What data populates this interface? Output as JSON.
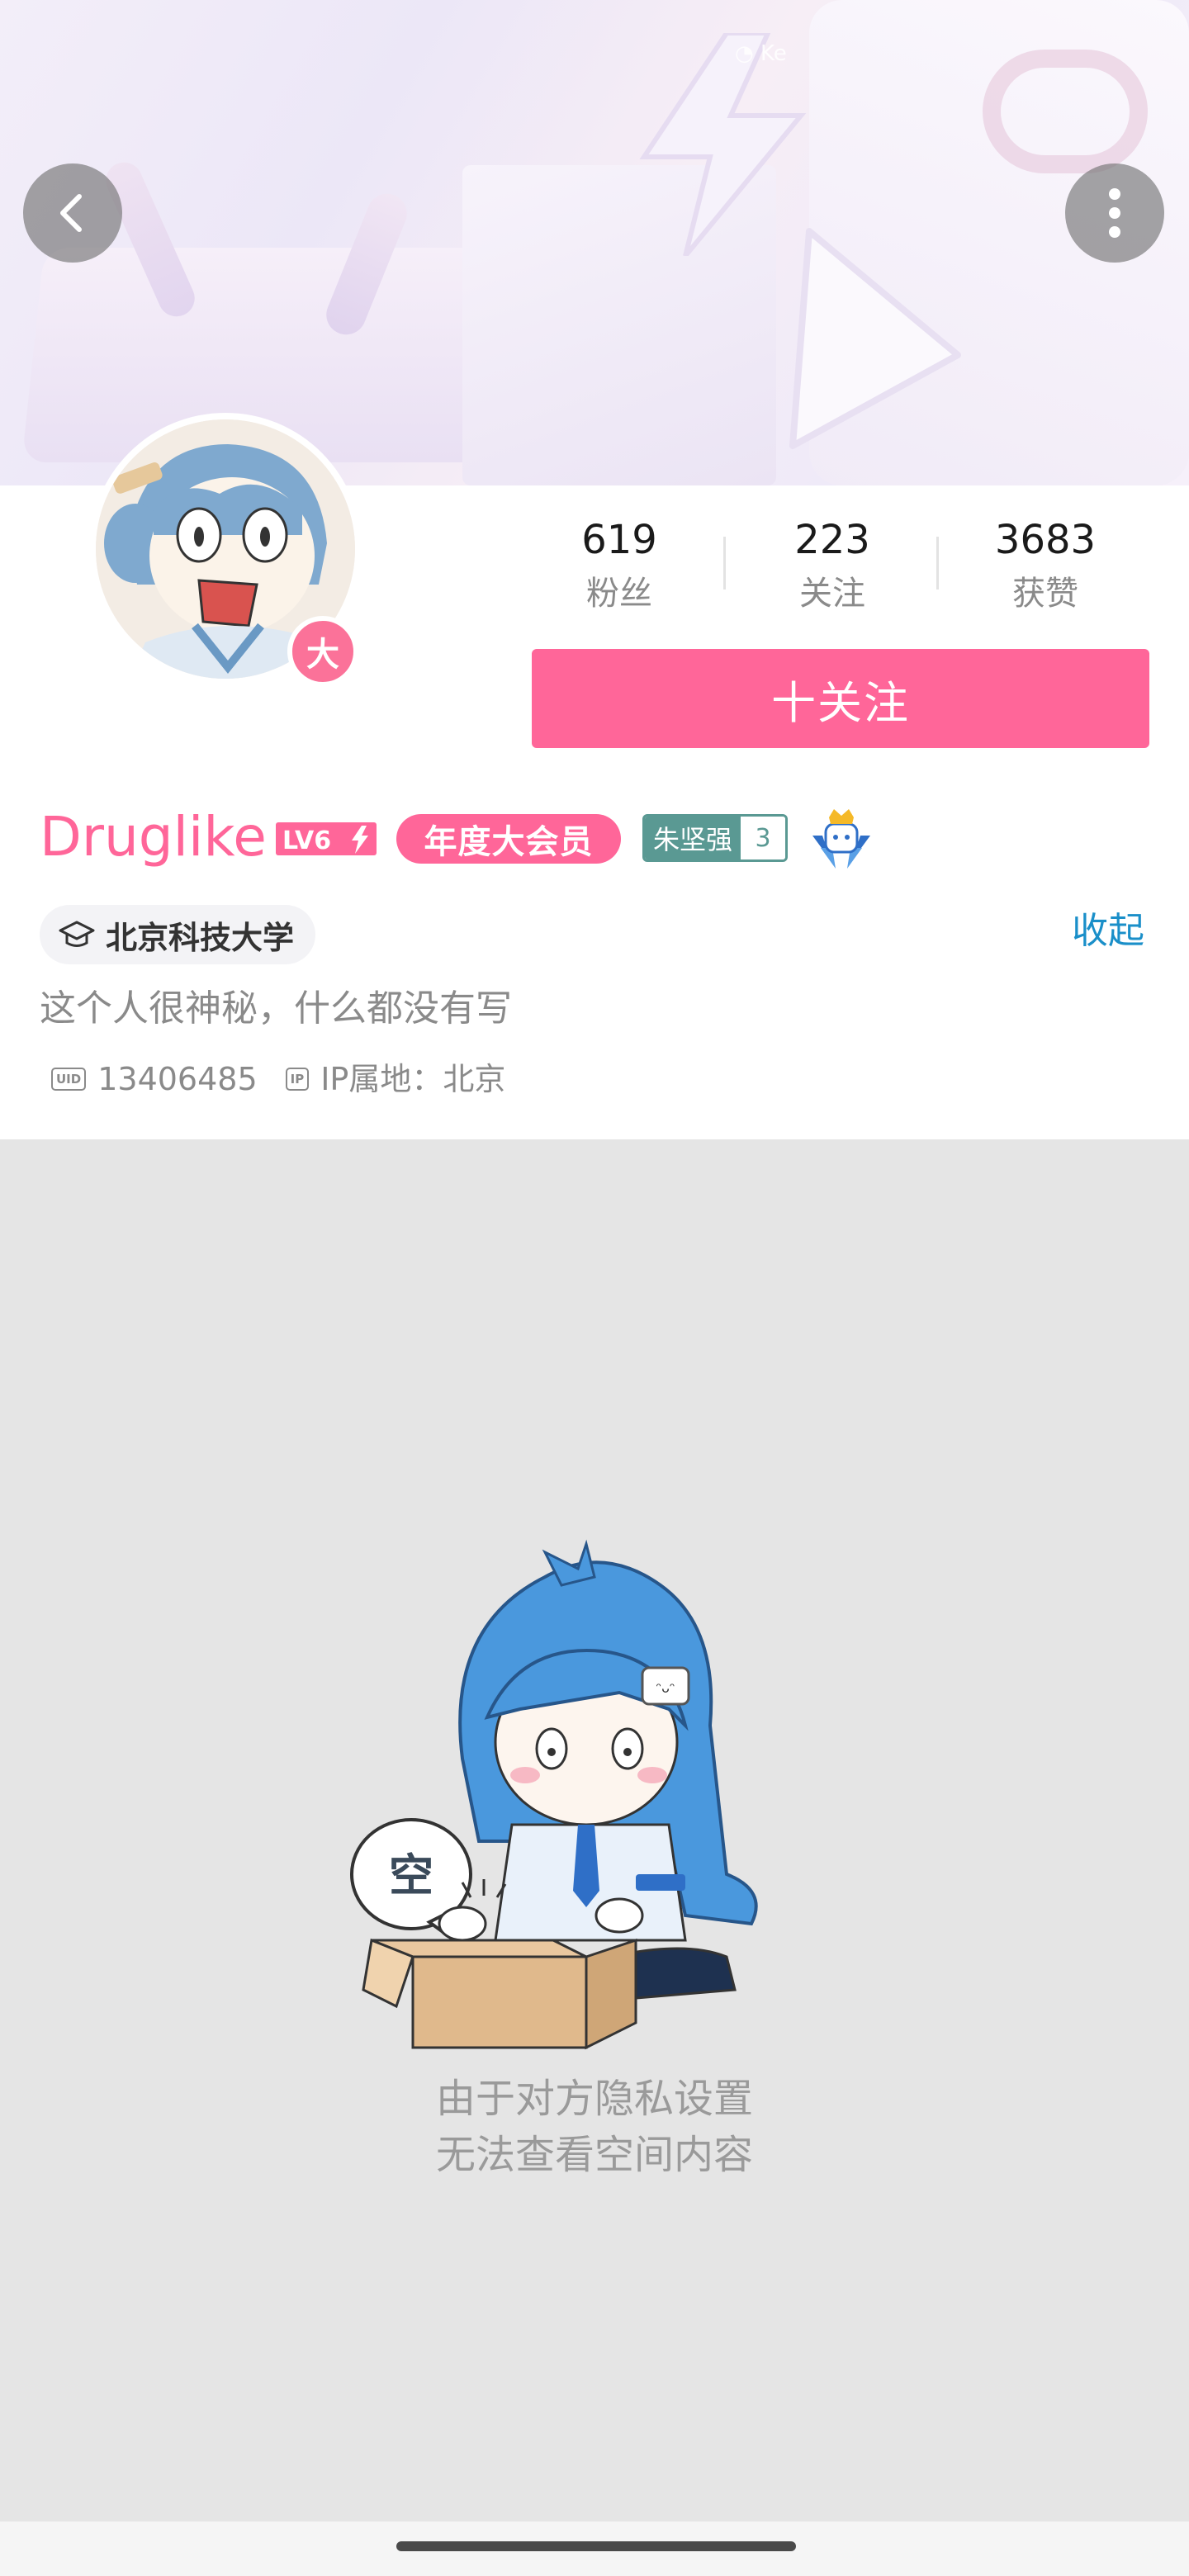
{
  "banner": {
    "logo_text": "◔ Ke"
  },
  "nav": {
    "back_icon": "chevron-left-icon",
    "more_icon": "more-vertical-icon"
  },
  "stats": [
    {
      "value": "619",
      "label": "粉丝"
    },
    {
      "value": "223",
      "label": "关注"
    },
    {
      "value": "3683",
      "label": "获赞"
    }
  ],
  "follow_button": {
    "label": "十关注"
  },
  "avatar": {
    "vip_badge": "大"
  },
  "profile": {
    "username": "Druglike",
    "level": "LV6",
    "vip_tag": "年度大会员",
    "medal_name": "朱坚强",
    "medal_level": "3",
    "school": "北京科技大学",
    "collapse": "收起",
    "bio": "这个人很神秘，什么都没有写",
    "uid_icon": "UID",
    "uid": "13406485",
    "ip_icon": "IP",
    "ip_location": "IP属地：北京"
  },
  "empty": {
    "bubble_text": "空",
    "line1": "由于对方隐私设置",
    "line2": "无法查看空间内容"
  },
  "colors": {
    "brand_pink": "#ff6699",
    "link_blue": "#1a8fc9",
    "medal_teal": "#5a9993"
  }
}
